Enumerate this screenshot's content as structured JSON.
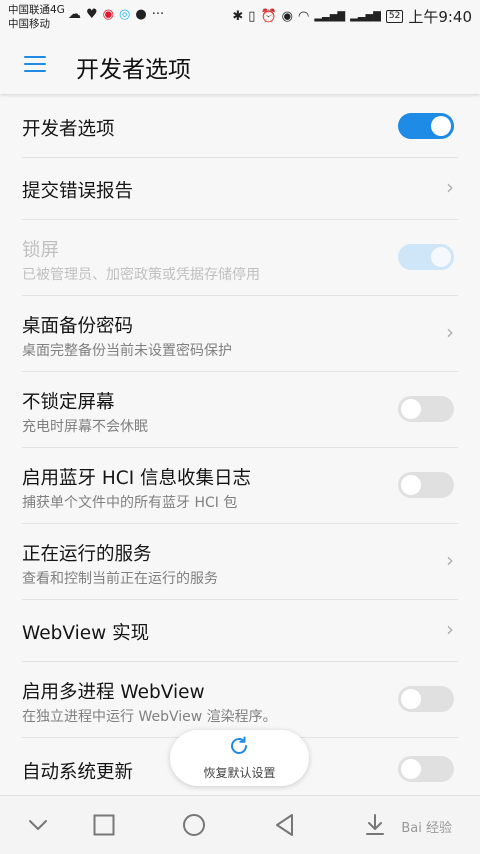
{
  "status_bar": {
    "carrier_1": "中国联通4G",
    "carrier_2": "中国移动",
    "battery": "52",
    "time": "上午9:40",
    "signal_labels": [
      "4G",
      "G"
    ]
  },
  "app_bar": {
    "title": "开发者选项",
    "menu_icon": "hamburger-icon"
  },
  "settings": [
    {
      "title": "开发者选项",
      "control": "switch",
      "on": true,
      "enabled": true
    },
    {
      "title": "提交错误报告",
      "control": "chevron",
      "enabled": true
    },
    {
      "title": "锁屏",
      "subtitle": "已被管理员、加密政策或凭据存储停用",
      "control": "switch",
      "on": true,
      "enabled": false
    },
    {
      "title": "桌面备份密码",
      "subtitle": "桌面完整备份当前未设置密码保护",
      "control": "chevron",
      "enabled": true
    },
    {
      "title": "不锁定屏幕",
      "subtitle": "充电时屏幕不会休眠",
      "control": "switch",
      "on": false,
      "enabled": true
    },
    {
      "title": "启用蓝牙 HCI 信息收集日志",
      "subtitle": "捕获单个文件中的所有蓝牙 HCI 包",
      "control": "switch",
      "on": false,
      "enabled": true
    },
    {
      "title": "正在运行的服务",
      "subtitle": "查看和控制当前正在运行的服务",
      "control": "chevron",
      "enabled": true
    },
    {
      "title": "WebView 实现",
      "control": "chevron",
      "enabled": true
    },
    {
      "title": "启用多进程 WebView",
      "subtitle": "在独立进程中运行 WebView 渲染程序。",
      "control": "switch",
      "on": false,
      "enabled": true
    },
    {
      "title": "自动系统更新",
      "control": "switch",
      "on": false,
      "enabled": true
    }
  ],
  "restore_button": {
    "label": "恢复默认设置",
    "icon": "refresh-icon"
  },
  "nav_bar": {
    "icons": [
      "chevron-down-icon",
      "recent-apps-icon",
      "home-icon",
      "back-icon",
      "download-icon"
    ],
    "watermark": "Bai 经验"
  },
  "colors": {
    "accent": "#1e8be6",
    "background": "#f7f7f7",
    "switch_off": "#e0e0e0",
    "switch_disabled": "#cfe5f8"
  }
}
